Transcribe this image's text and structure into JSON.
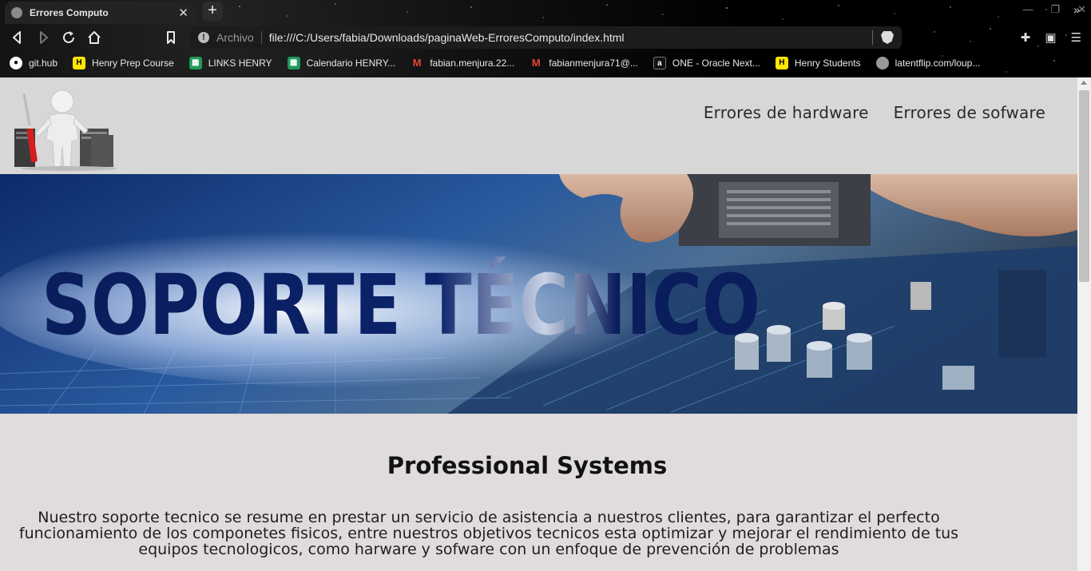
{
  "browser": {
    "tab_title": "Errores Computo",
    "tab_close": "✕",
    "new_tab": "+",
    "address": {
      "scheme_label": "Archivo",
      "url": "file:///C:/Users/fabia/Downloads/paginaWeb-ErroresComputo/index.html"
    },
    "bookmarks": [
      {
        "label": "git.hub",
        "icon": "github-icon"
      },
      {
        "label": "Henry Prep Course",
        "icon": "henry-icon"
      },
      {
        "label": "LINKS HENRY",
        "icon": "sheets-icon"
      },
      {
        "label": "Calendario HENRY...",
        "icon": "sheets-icon"
      },
      {
        "label": "fabian.menjura.22...",
        "icon": "gmail-icon"
      },
      {
        "label": "fabianmenjura71@...",
        "icon": "gmail-icon"
      },
      {
        "label": "ONE - Oracle Next...",
        "icon": "alura-icon"
      },
      {
        "label": "Henry Students",
        "icon": "henry-icon"
      },
      {
        "label": "latentflip.com/loup...",
        "icon": "globe-icon"
      }
    ],
    "bookmarks_more": "»"
  },
  "site": {
    "nav": [
      "Errores de hardware",
      "Errores de sofware"
    ],
    "hero_text": "SOPORTE TÉCNICO",
    "heading": "Professional Systems",
    "paragraph": "Nuestro soporte tecnico se resume en prestar un servicio de asistencia a nuestros clientes, para garantizar el perfecto funcionamiento de los componetes fisicos, entre nuestros objetivos tecnicos esta optimizar y mejorar el rendimiento de tus equipos tecnologicos, como harware y sofware con un enfoque de prevención de problemas"
  },
  "colors": {
    "header_bg": "#d7d7d7",
    "content_bg": "#e0dcdc",
    "hero_navy": "#0a1d5c"
  }
}
